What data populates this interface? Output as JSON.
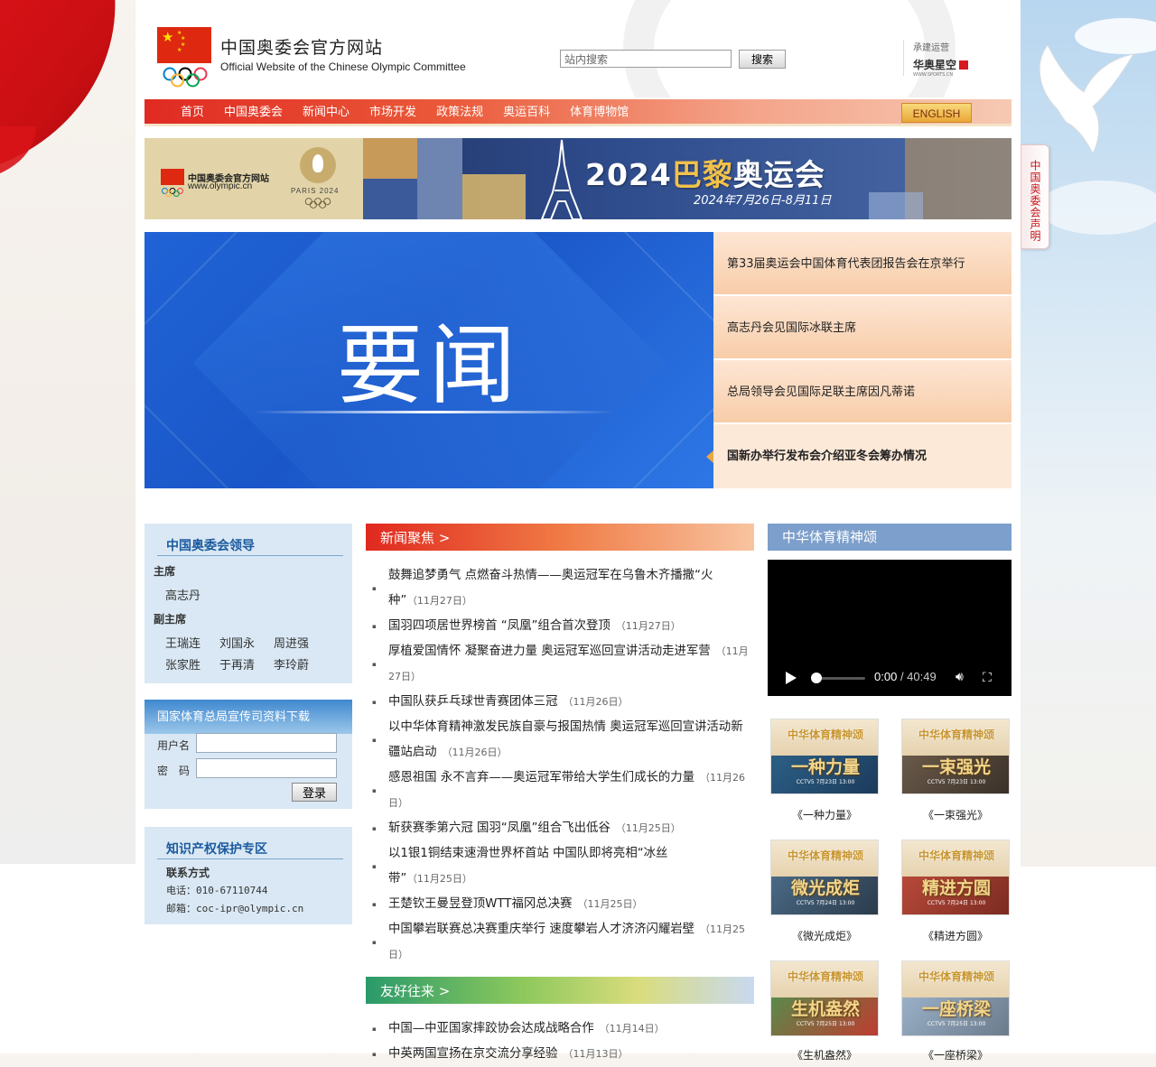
{
  "site": {
    "title": "中国奥委会官方网站",
    "subtitle": "Official Website of the Chinese Olympic Committee"
  },
  "search": {
    "placeholder": "站内搜索",
    "button": "搜索"
  },
  "operator": {
    "label": "承建运营",
    "brand": "华奥星空",
    "url": "WWW.SPORTS.CN"
  },
  "side_tab": "中国奥委会声明",
  "nav": {
    "items": [
      "首页",
      "中国奥委会",
      "新闻中心",
      "市场开发",
      "政策法规",
      "奥运百科",
      "体育博物馆"
    ],
    "english": "ENGLISH"
  },
  "paris_banner": {
    "site_name": "中国奥委会官方网站",
    "site_url": "www.olympic.cn",
    "paris_label": "PARIS 2024",
    "title_year": "2024",
    "title_city": "巴黎",
    "title_event": "奥运会",
    "dates": "2024年7月26日-8月11日"
  },
  "headline": {
    "image_text": "要闻",
    "items": [
      "第33届奥运会中国体育代表团报告会在京举行",
      "高志丹会见国际冰联主席",
      "总局领导会见国际足联主席因凡蒂诺",
      "国新办举行发布会介绍亚冬会筹办情况"
    ],
    "active_index": 3
  },
  "leaders": {
    "title": "中国奥委会领导",
    "chair_label": "主席",
    "chair": "高志丹",
    "vice_label": "副主席",
    "vice": [
      "王瑞连",
      "刘国永",
      "周进强",
      "张家胜",
      "于再清",
      "李玲蔚"
    ]
  },
  "download": {
    "title": "国家体育总局宣传司资料下载",
    "user_label": "用户名",
    "pass_label": "密　码",
    "login": "登录"
  },
  "ip": {
    "title": "知识产权保护专区",
    "contact_label": "联系方式",
    "phone": "电话：010-67110744",
    "email": "邮箱：coc-ipr@olympic.cn"
  },
  "news": {
    "title": "新闻聚焦 >",
    "items": [
      {
        "text": "鼓舞追梦勇气 点燃奋斗热情——奥运冠军在乌鲁木齐播撒“火种”",
        "date": "（11月27日）"
      },
      {
        "text": "国羽四项居世界榜首 “凤凰”组合首次登顶",
        "date": "（11月27日）"
      },
      {
        "text": "厚植爱国情怀 凝聚奋进力量 奥运冠军巡回宣讲活动走进军营",
        "date": "（11月27日）"
      },
      {
        "text": "中国队获乒乓球世青赛团体三冠",
        "date": "（11月26日）"
      },
      {
        "text": "以中华体育精神激发民族自豪与报国热情 奥运冠军巡回宣讲活动新疆站启动",
        "date": "（11月26日）"
      },
      {
        "text": "感恩祖国 永不言弃——奥运冠军带给大学生们成长的力量",
        "date": "（11月26日）"
      },
      {
        "text": "斩获赛季第六冠 国羽“凤凰”组合飞出低谷",
        "date": "（11月25日）"
      },
      {
        "text": "以1银1铜结束速滑世界杯首站 中国队即将亮相“冰丝带”",
        "date": "（11月25日）"
      },
      {
        "text": "王楚钦王曼昱登顶WTT福冈总决赛",
        "date": "（11月25日）"
      },
      {
        "text": "中国攀岩联赛总决赛重庆举行 速度攀岩人才济济闪耀岩壁",
        "date": "（11月25日）"
      }
    ]
  },
  "friendship": {
    "title": "友好往来 >",
    "items": [
      {
        "text": "中国—中亚国家摔跤协会达成战略合作",
        "date": "（11月14日）"
      },
      {
        "text": "中英两国宣扬在京交流分享经验",
        "date": "（11月13日）"
      }
    ]
  },
  "spirit": {
    "title": "中华体育精神颂",
    "video": {
      "current": "0:00",
      "duration": "/ 40:49"
    },
    "thumbs": [
      {
        "series": "中华体育精神颂",
        "name": "一种力量",
        "cctv": "CCTV5 7月23日 13:00",
        "caption": "《一种力量》"
      },
      {
        "series": "中华体育精神颂",
        "name": "一束强光",
        "cctv": "CCTV5 7月23日 13:00",
        "caption": "《一束强光》"
      },
      {
        "series": "中华体育精神颂",
        "name": "微光成炬",
        "cctv": "CCTV5 7月24日 13:00",
        "caption": "《微光成炬》"
      },
      {
        "series": "中华体育精神颂",
        "name": "精进方圆",
        "cctv": "CCTV5 7月24日 13:00",
        "caption": "《精进方圆》"
      },
      {
        "series": "中华体育精神颂",
        "name": "生机盎然",
        "cctv": "CCTV5 7月25日 13:00",
        "caption": "《生机盎然》"
      },
      {
        "series": "中华体育精神颂",
        "name": "一座桥梁",
        "cctv": "CCTV5 7月25日 13:00",
        "caption": "《一座桥梁》"
      }
    ]
  },
  "colors": {
    "nav_red": "#e02a22",
    "headline_blue": "#1f63d6",
    "link_blue": "#1c5a9e",
    "spirit_blue": "#7d9fcb"
  }
}
